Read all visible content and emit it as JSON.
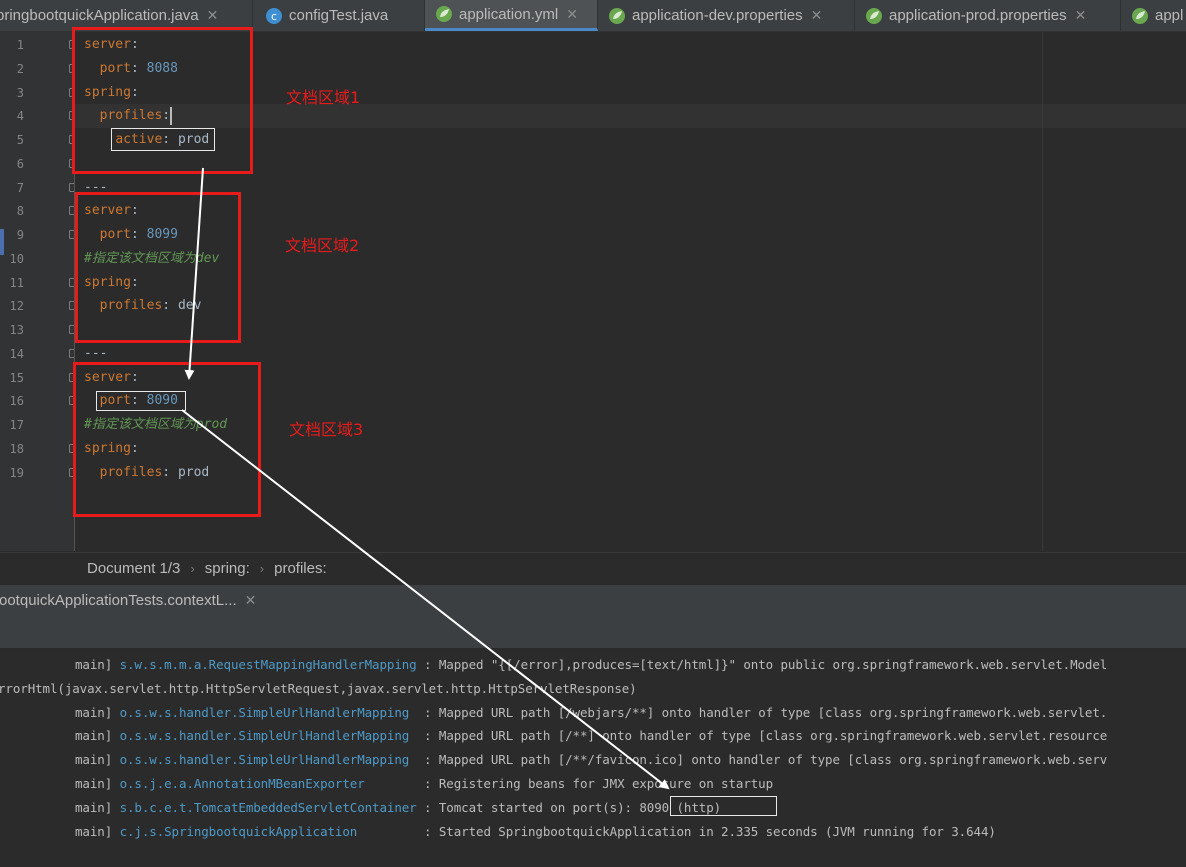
{
  "tabs": [
    {
      "label": "pringbootquickApplication.java",
      "active": false
    },
    {
      "label": "configTest.java",
      "active": false
    },
    {
      "label": "application.yml",
      "active": true
    },
    {
      "label": "application-dev.properties",
      "active": false
    },
    {
      "label": "application-prod.properties",
      "active": false
    },
    {
      "label": "appl",
      "active": false
    }
  ],
  "editor": {
    "line_numbers": [
      "1",
      "2",
      "3",
      "4",
      "5",
      "6",
      "7",
      "8",
      "9",
      "10",
      "11",
      "12",
      "13",
      "14",
      "15",
      "16",
      "17",
      "18",
      "19"
    ],
    "lines": [
      {
        "n": 1,
        "key": "server",
        "sep": ":"
      },
      {
        "n": 2,
        "key": "port",
        "sep": ": ",
        "num": "8088"
      },
      {
        "n": 3,
        "key": "spring",
        "sep": ":"
      },
      {
        "n": 4,
        "key": "profiles",
        "sep": ":"
      },
      {
        "n": 5,
        "key": "active",
        "sep": ": ",
        "value": "prod"
      },
      {
        "n": 7,
        "text": "---"
      },
      {
        "n": 8,
        "key": "server",
        "sep": ":"
      },
      {
        "n": 9,
        "key": "port",
        "sep": ": ",
        "num": "8099"
      },
      {
        "n": 10,
        "comment": "#指定该文档区域为dev"
      },
      {
        "n": 11,
        "key": "spring",
        "sep": ":"
      },
      {
        "n": 12,
        "key": "profiles",
        "sep": ": ",
        "value": "dev"
      },
      {
        "n": 14,
        "text": "---"
      },
      {
        "n": 15,
        "key": "server",
        "sep": ":"
      },
      {
        "n": 16,
        "key": "port",
        "sep": ": ",
        "num": "8090"
      },
      {
        "n": 17,
        "comment": "#指定该文档区域为prod"
      },
      {
        "n": 18,
        "key": "spring",
        "sep": ":"
      },
      {
        "n": 19,
        "key": "profiles",
        "sep": ": ",
        "value": "prod"
      }
    ]
  },
  "annotations": {
    "region1": "文档区域1",
    "region2": "文档区域2",
    "region3": "文档区域3",
    "color": "#e81b1b"
  },
  "breadcrumb": {
    "doc": "Document 1/3",
    "spring": "spring:",
    "profiles": "profiles:"
  },
  "run_tab": {
    "label": "ootquickApplicationTests.contextL..."
  },
  "console": {
    "lines": [
      {
        "prefix": "main]",
        "logger": "s.w.s.m.m.a.RequestMappingHandlerMapping",
        "msg": " : Mapped \"{[/error],produces=[text/html]}\" onto public org.springframework.web.servlet.Model"
      },
      {
        "raw": "rrorHtml(javax.servlet.http.HttpServletRequest,javax.servlet.http.HttpServletResponse)"
      },
      {
        "prefix": "main]",
        "logger": "o.s.w.s.handler.SimpleUrlHandlerMapping",
        "msg": "  : Mapped URL path [/webjars/**] onto handler of type [class org.springframework.web.servlet."
      },
      {
        "prefix": "main]",
        "logger": "o.s.w.s.handler.SimpleUrlHandlerMapping",
        "msg": "  : Mapped URL path [/**] onto handler of type [class org.springframework.web.servlet.resource"
      },
      {
        "prefix": "main]",
        "logger": "o.s.w.s.handler.SimpleUrlHandlerMapping",
        "msg": "  : Mapped URL path [/**/favicon.ico] onto handler of type [class org.springframework.web.serv"
      },
      {
        "prefix": "main]",
        "logger": "o.s.j.e.a.AnnotationMBeanExporter",
        "msg": "        : Registering beans for JMX exposure on startup"
      },
      {
        "prefix": "main]",
        "logger": "s.b.c.e.t.TomcatEmbeddedServletContainer",
        "msg": " : Tomcat started on port(s): 8090 (http)"
      },
      {
        "prefix": "main]",
        "logger": "c.j.s.SpringbootquickApplication",
        "msg": "         : Started SpringbootquickApplication in 2.335 seconds (JVM running for 3.644)"
      }
    ]
  },
  "colors": {
    "key": "#cc7832",
    "number": "#6897bb",
    "comment": "#629755",
    "logger": "#4e9ac7",
    "tab_accent": "#4a88c7"
  },
  "icons": {
    "java_tab": "java-class-icon",
    "spring_tab": "spring-leaf-icon"
  }
}
